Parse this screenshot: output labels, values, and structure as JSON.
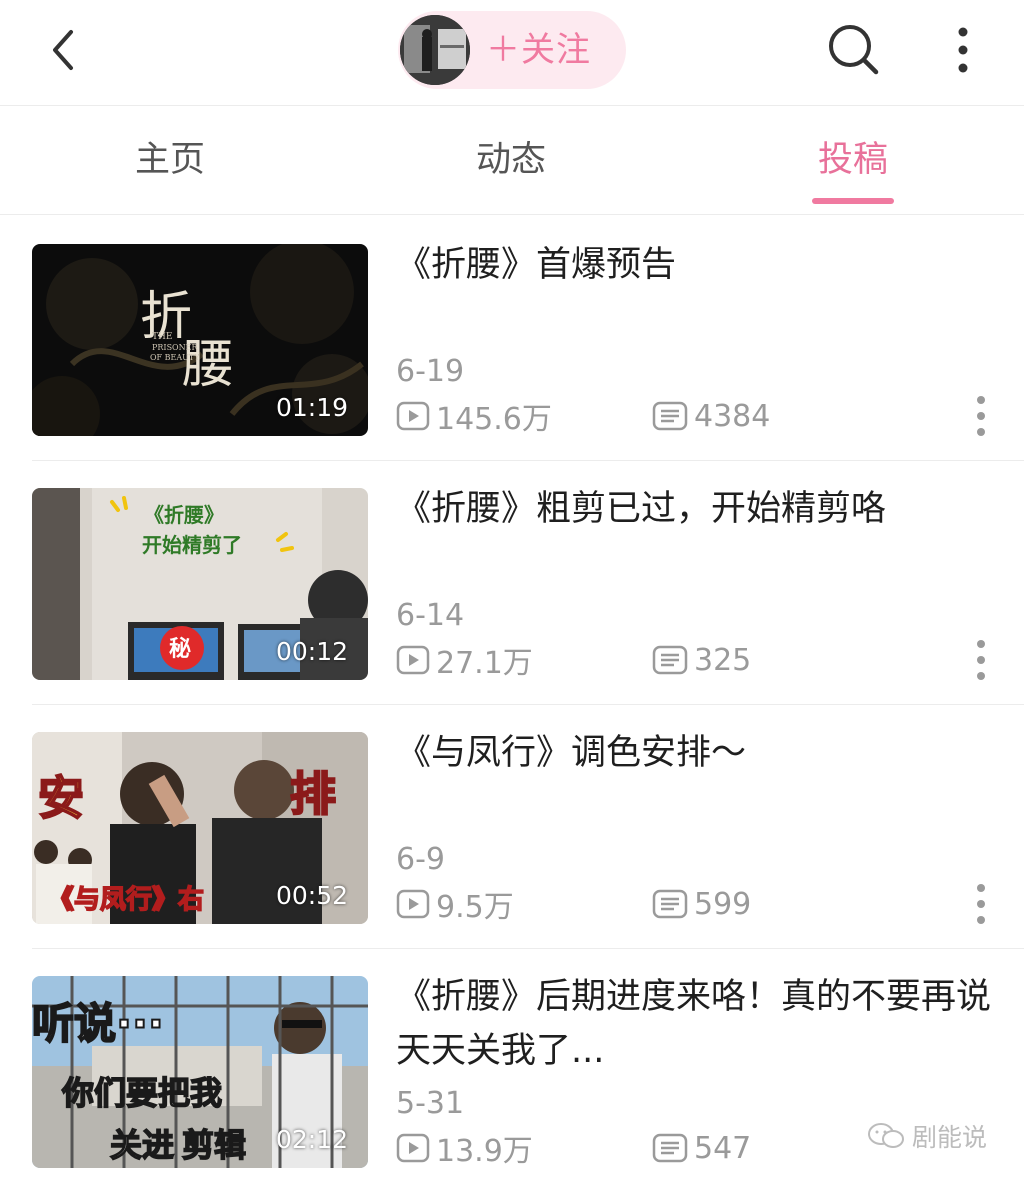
{
  "header": {
    "follow_label": "＋关注"
  },
  "tabs": [
    {
      "label": "主页"
    },
    {
      "label": "动态"
    },
    {
      "label": "投稿"
    }
  ],
  "active_tab": "投稿",
  "videos": [
    {
      "title": "《折腰》首爆预告",
      "date": "6-19",
      "duration": "01:19",
      "views": "145.6万",
      "comments": "4384",
      "thumb_text": [
        "折",
        "腰",
        "THE",
        "PRISONER",
        "OF BEAUTY"
      ]
    },
    {
      "title": "《折腰》粗剪已过，开始精剪咯",
      "date": "6-14",
      "duration": "00:12",
      "views": "27.1万",
      "comments": "325",
      "thumb_text": [
        "《折腰》",
        "开始精剪了",
        "秘"
      ]
    },
    {
      "title": "《与凤行》调色安排～",
      "date": "6-9",
      "duration": "00:52",
      "views": "9.5万",
      "comments": "599",
      "thumb_text": [
        "安",
        "排",
        "《与凤行》右"
      ]
    },
    {
      "title": "《折腰》后期进度来咯！真的不要再说天天关我了...",
      "date": "5-31",
      "duration": "02:12",
      "views": "13.9万",
      "comments": "547",
      "thumb_text": [
        "听说···",
        "你们要把我",
        "关进",
        "剪辑"
      ]
    }
  ],
  "watermark": "剧能说",
  "colors": {
    "accent": "#f07aa0",
    "accent_bg": "#fdeaf0",
    "meta_gray": "#9a9a9a"
  },
  "icons": [
    "back-arrow-icon",
    "search-icon",
    "more-vertical-icon",
    "play-icon",
    "comment-icon",
    "wechat-icon"
  ]
}
